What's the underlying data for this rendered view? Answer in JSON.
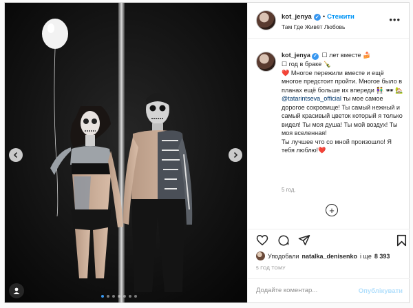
{
  "post": {
    "username": "kot_jenya",
    "follow_label": "Стежити",
    "location": "Там Где Живёт Любовь",
    "more_icon": "more-horizontal-icon",
    "verified_mark": "✓"
  },
  "caption": {
    "username": "kot_jenya",
    "lines": [
      " ☐ лет вместе 🍰",
      "☐ год в браке 🍾",
      "❤️ Многое пережили вместе и ещё многое предстоит пройти. Многое было в планах ещё больше их впереди 👫 🕶 🏡"
    ],
    "mention": "@tatarintseva_official",
    "body": " ты мое самое дорогое сокровище! Ты самый нежный и самый красивый цветок который я только видел! Ты моя душа! Ты мой воздух! Ты моя вселенная!",
    "closing": "Ты лучшее что со мной произошло! Я тебя люблю!",
    "closing_heart": "❤️",
    "age": "5 год."
  },
  "likes": {
    "prefix": "Уподобали",
    "user": "natalka_denisenko",
    "middle": "і ще",
    "count": "8 393"
  },
  "timestamp": "5 ГОД ТОМУ",
  "comment": {
    "placeholder": "Додайте коментар...",
    "publish_label": "Опублікувати"
  },
  "carousel": {
    "dot_count": 7,
    "active_index": 0
  },
  "colors": {
    "accent": "#0095f6",
    "mention": "#00376b",
    "heart": "#ed4956",
    "muted": "#8e8e8e"
  }
}
